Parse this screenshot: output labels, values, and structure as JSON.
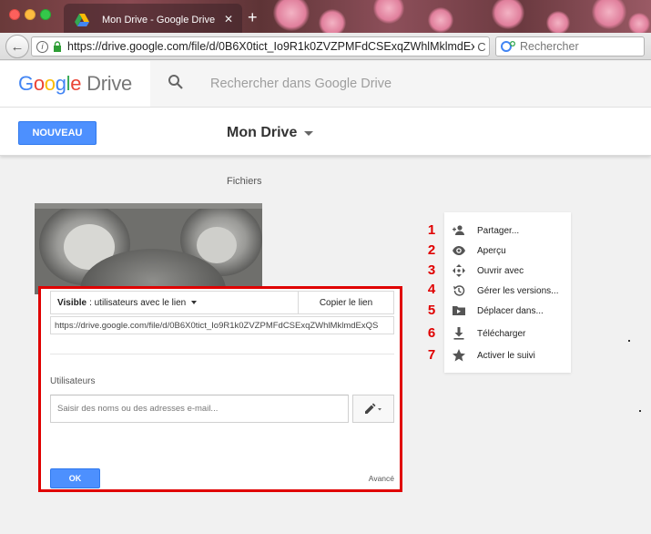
{
  "browser": {
    "tab_title": "Mon Drive - Google Drive",
    "tab_close": "✕",
    "new_tab": "+",
    "url": "https://drive.google.com/file/d/0B6X0tict_Io9R1k0ZVZPMFdCSExqZWhlMklmdExQS",
    "search_placeholder": "Rechercher",
    "back_glyph": "←",
    "reload_glyph": "C",
    "info_glyph": "i"
  },
  "header": {
    "logo_google": [
      "G",
      "o",
      "o",
      "g",
      "l",
      "e"
    ],
    "logo_product": "Drive",
    "search_placeholder": "Rechercher dans Google Drive",
    "new_button": "NOUVEAU",
    "breadcrumb": "Mon Drive"
  },
  "main": {
    "section_label": "Fichiers"
  },
  "context_menu": {
    "items": [
      {
        "number": "1",
        "label": "Partager...",
        "icon": "person-add-icon"
      },
      {
        "number": "2",
        "label": "Aperçu",
        "icon": "eye-icon"
      },
      {
        "number": "3",
        "label": "Ouvrir avec",
        "icon": "move-arrows-icon"
      },
      {
        "number": "4",
        "label": "Gérer les versions...",
        "icon": "history-icon"
      },
      {
        "number": "5",
        "label": "Déplacer dans...",
        "icon": "folder-move-icon"
      },
      {
        "number": "6",
        "label": "Télécharger",
        "icon": "download-icon"
      },
      {
        "number": "7",
        "label": "Activer le suivi",
        "icon": "star-icon"
      }
    ]
  },
  "share_dialog": {
    "visibility_bold": "Visible",
    "visibility_rest": ": utilisateurs avec le lien",
    "copy_link": "Copier le lien",
    "link": "https://drive.google.com/file/d/0B6X0tict_Io9R1k0ZVZPMFdCSExqZWhlMklmdExQS",
    "users_label": "Utilisateurs",
    "people_placeholder": "Saisir des noms ou des adresses e-mail...",
    "ok": "OK",
    "advanced": "Avancé"
  },
  "colors": {
    "accent_blue": "#4d90fe",
    "highlight_red": "#e00000"
  }
}
